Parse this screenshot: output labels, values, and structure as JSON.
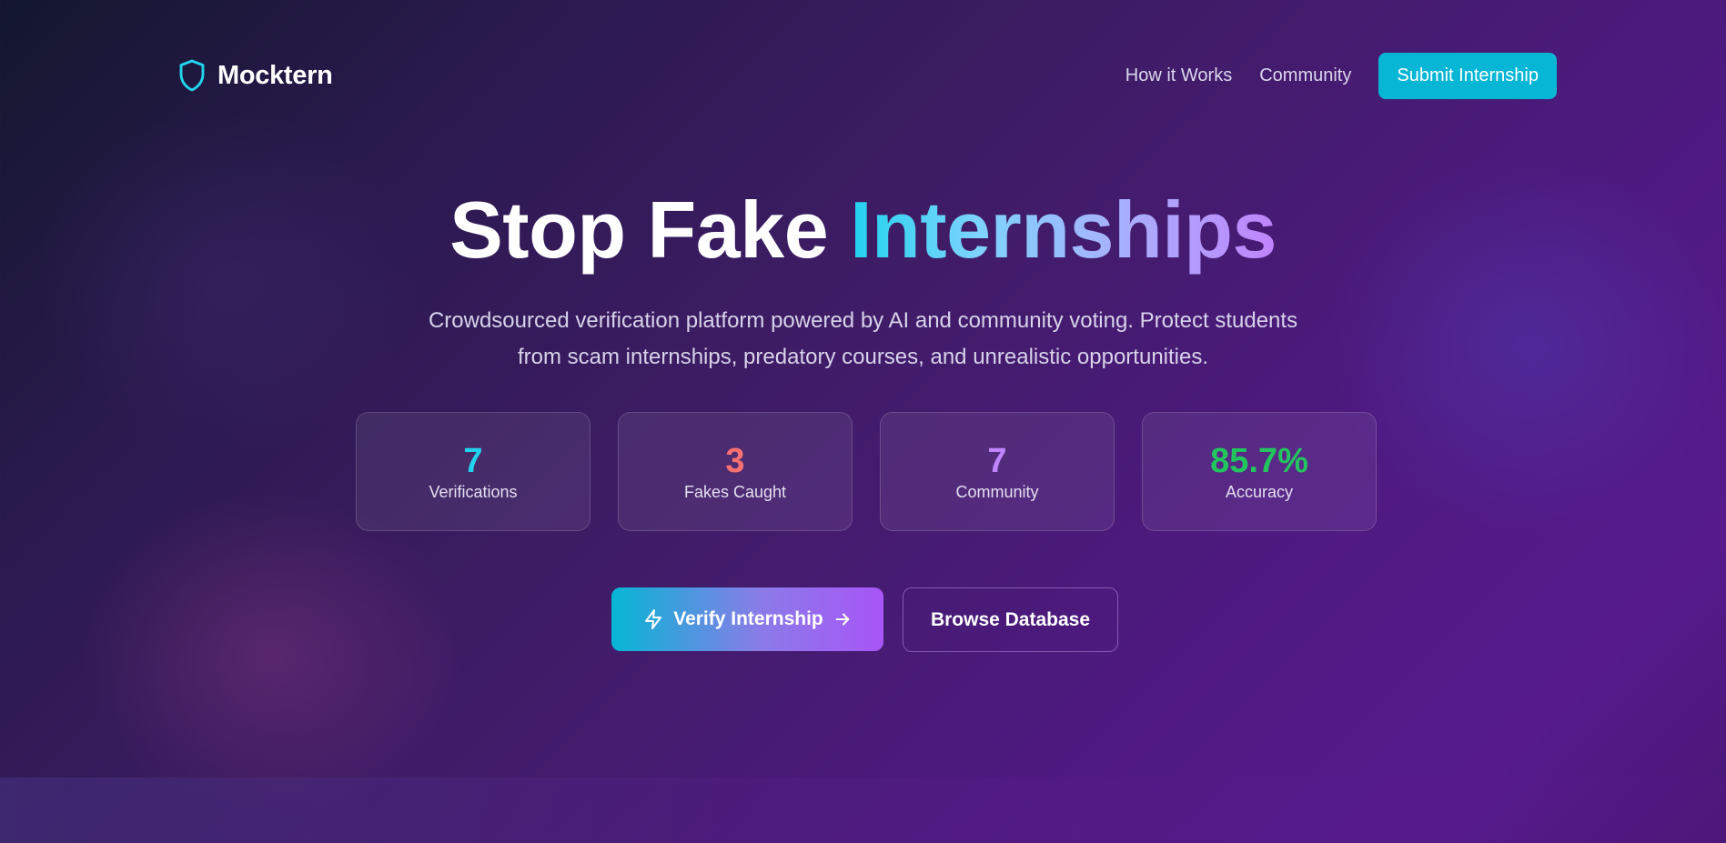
{
  "brand": {
    "name": "Mocktern",
    "icon": "shield-icon"
  },
  "nav": {
    "links": [
      "How it Works",
      "Community"
    ],
    "cta_label": "Submit Internship"
  },
  "hero": {
    "title_plain": "Stop Fake",
    "title_accent": "Internships",
    "description": "Crowdsourced verification platform powered by AI and community voting. Protect students from scam internships, predatory courses, and unrealistic opportunities."
  },
  "stats": [
    {
      "value": "7",
      "label": "Verifications",
      "color": "#22d3ee"
    },
    {
      "value": "3",
      "label": "Fakes Caught",
      "color": "#f87171"
    },
    {
      "value": "7",
      "label": "Community",
      "color": "#c084fc"
    },
    {
      "value": "85.7%",
      "label": "Accuracy",
      "color": "#22c55e"
    }
  ],
  "cta": {
    "verify_label": "Verify Internship",
    "verify_icon": "zap-icon",
    "verify_arrow_icon": "arrow-right-icon",
    "browse_label": "Browse Database"
  },
  "colors": {
    "accent_cyan": "#06b6d4",
    "accent_purple": "#a855f7"
  }
}
